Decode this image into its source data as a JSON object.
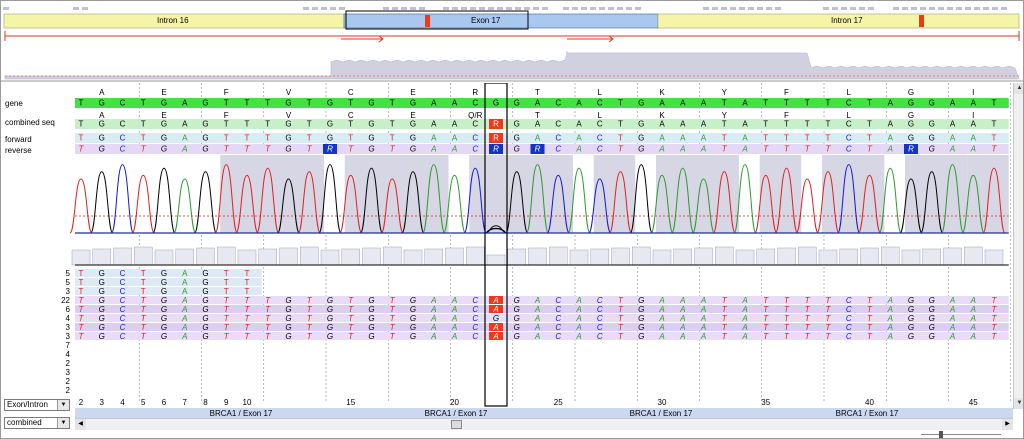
{
  "overview": {
    "intron_left": "Intron 16",
    "exon": "Exon 17",
    "intron_right": "Intron 17"
  },
  "track_labels": {
    "gene": "gene",
    "combined": "combined seq",
    "forward": "forward",
    "reverse": "reverse"
  },
  "amino_acids": [
    "A",
    "E",
    "F",
    "V",
    "C",
    "E",
    "R",
    "T",
    "L",
    "K",
    "Y",
    "F",
    "L",
    "G",
    "I"
  ],
  "amino_acids_combined": [
    "A",
    "E",
    "F",
    "V",
    "C",
    "E",
    "Q/R",
    "T",
    "L",
    "K",
    "Y",
    "F",
    "L",
    "G",
    "I"
  ],
  "gene_seq": "TGCTGAGTTTGTGTGTGAACGGACACTGAAATATTTTCTAGGAAT",
  "combined_seq": "TGCTGAGTTTGTGTGTGAACRGACACTGAAATATTTTCTAGGAAT",
  "forward_seq": "TGCTGAGTTTGTGTGTGAACRGACACTGAAATATTTTCTAGGAAT",
  "reverse_seq": "TGCTGAGTTTGTRTGTGAACRGRCACTGAAATATTTTCTARGAAT",
  "read_counts": [
    "5",
    "5",
    "3",
    "22",
    "6",
    "4",
    "3",
    "3",
    "7",
    "4",
    "2",
    "3",
    "2",
    "2"
  ],
  "reads": [
    "TGCTGAGTT",
    "TGCTGAGTT",
    "TGCTGAGTT",
    "TGCTGAGTTTGTGTGTGAACAGACACTGAAATATTTTCTAGGAAT",
    "TGCTGAGTTTGTGTGTGAACAGACACTGAAATATTTTCTAGGAAT",
    "TGCTGAGTTTGTGTGTGAACGGACACTGAAATATTTTCTAGGAAT",
    "TGCTGAGTTTGTGTGTGAACAGACACTGAAATATTTTCTAGGAAT",
    "TGCTGAGTTTGTGTGTGAACAGACACTGAAATATTTTCTAGGAAT"
  ],
  "ruler": [
    "2",
    "3",
    "4",
    "5",
    "6",
    "7",
    "8",
    "9",
    "10",
    "15",
    "20",
    "25",
    "30",
    "35",
    "40",
    "45"
  ],
  "footer_label": "BRCA1 / Exon 17",
  "controls": {
    "region_select": "Exon/Intron",
    "view_select": "combined"
  },
  "colors": {
    "A": "#2e9a2e",
    "C": "#1515d8",
    "G": "#000000",
    "T": "#e02020",
    "exon_band": "#a8c8f0",
    "intron_band": "#f5f5a8",
    "gene_bar": "#44e044",
    "combined_bar": "#c8f0c8",
    "forward_bar": "#d8ecf4",
    "reverse_bar": "#e4d8f4",
    "ambiguous": "#1433c8",
    "variant": "#ee3a1a",
    "quality": "#c8c8dc"
  }
}
